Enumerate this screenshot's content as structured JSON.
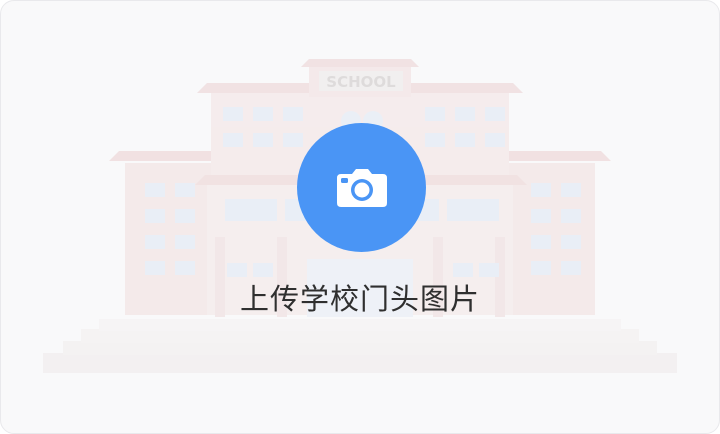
{
  "upload": {
    "label": "上传学校门头图片",
    "icon": "camera-icon",
    "accent_color": "#4a95f5"
  },
  "illustration": {
    "sign_text": "SCHOOL",
    "icon": "school-building-icon"
  }
}
